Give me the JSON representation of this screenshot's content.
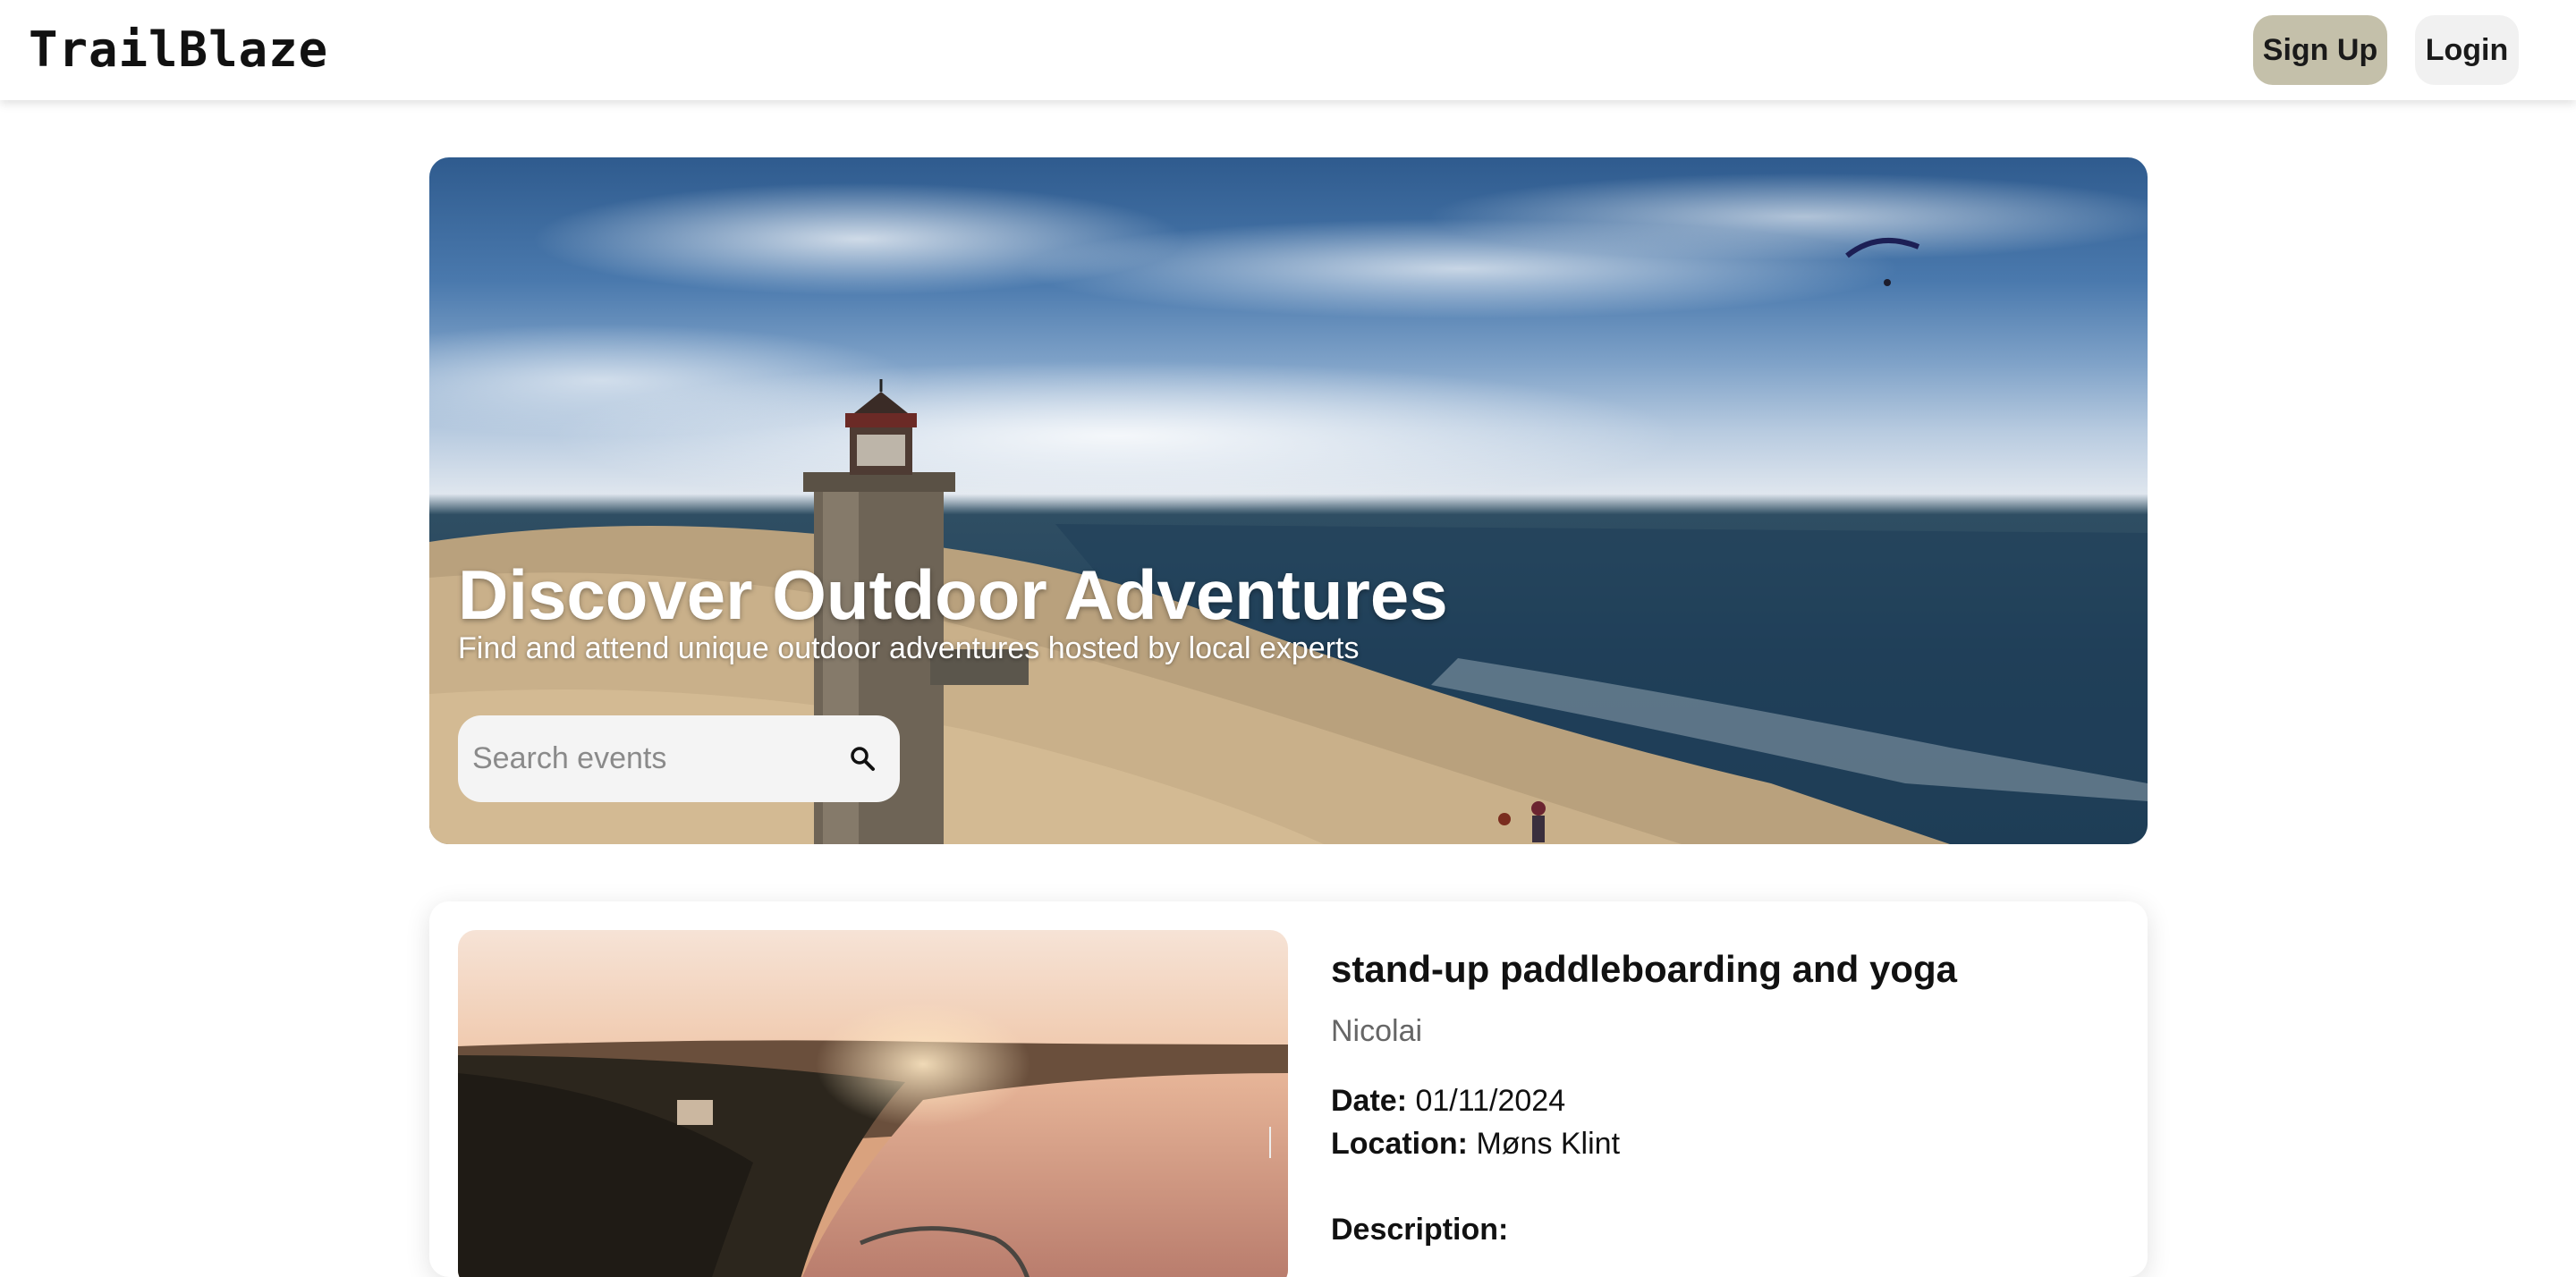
{
  "navbar": {
    "logo": "TrailBlaze",
    "signup_label": "Sign Up",
    "login_label": "Login"
  },
  "hero": {
    "title": "Discover Outdoor Adventures",
    "subtitle": "Find and attend unique outdoor adventures hosted by local experts",
    "search": {
      "placeholder": "Search events",
      "value": "",
      "icon": "search-icon"
    }
  },
  "events": [
    {
      "title": "stand-up paddleboarding and yoga",
      "host": "Nicolai",
      "date_label": "Date:",
      "date": "01/11/2024",
      "location_label": "Location:",
      "location": "Møns Klint",
      "description_label": "Description:"
    }
  ],
  "colors": {
    "signup_bg": "#c4c0aa",
    "login_bg": "#f1f1f1",
    "hero_text": "#ffffff"
  }
}
